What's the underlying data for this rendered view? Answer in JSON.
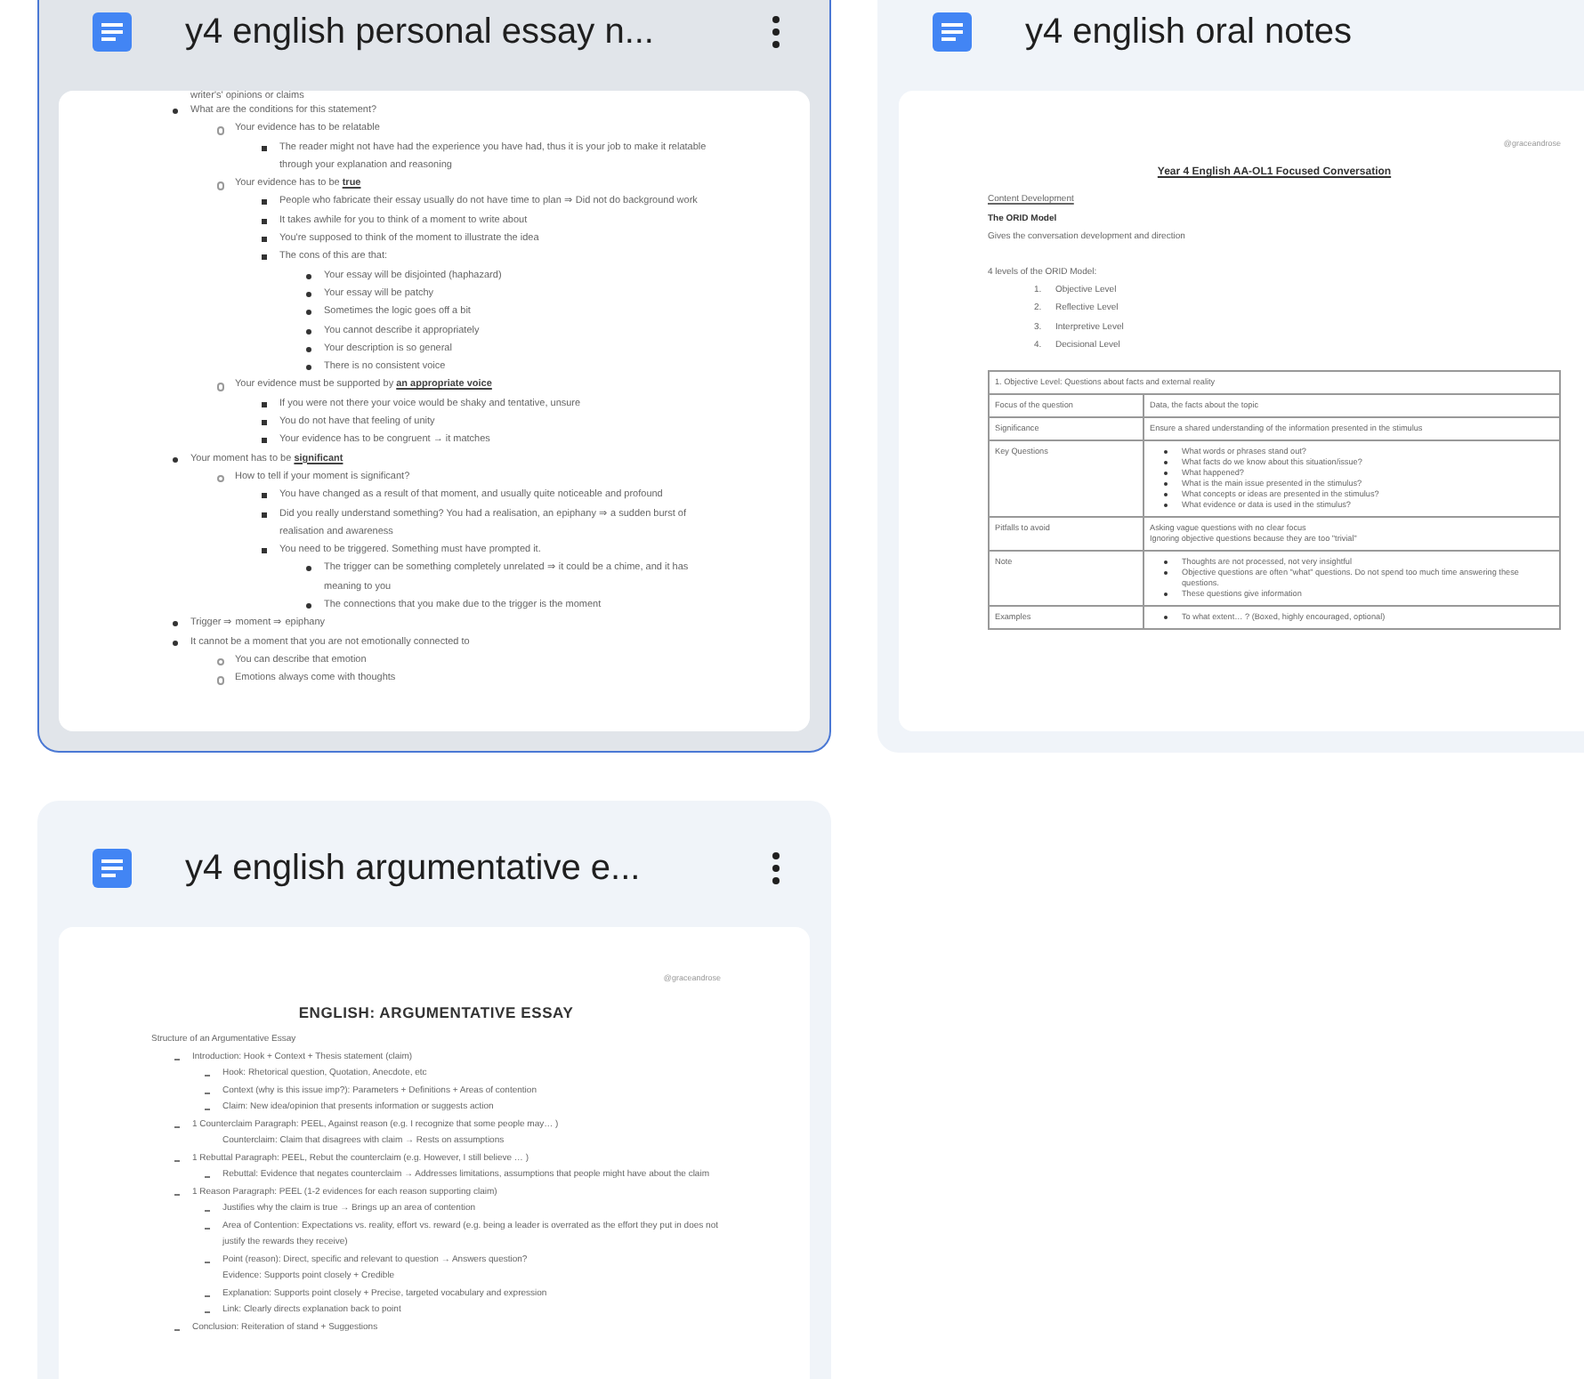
{
  "cards": [
    {
      "title": "y4 english personal essay n...",
      "selected": true,
      "preview": {
        "kind": "dotted_outline",
        "lead_text": "writer's' opinions or claims",
        "items": [
          {
            "text": "What are the conditions for this statement?",
            "children": [
              {
                "text": "Your evidence has to be relatable",
                "children": [
                  {
                    "text": "The reader might not have had the experience you have had, thus it is your job to make it relatable through your explanation and reasoning"
                  }
                ]
              },
              {
                "text": "Your evidence has to be **true**",
                "children": [
                  {
                    "text": "People who fabricate their essay usually do not have time to plan ⇒ Did not do background work"
                  },
                  {
                    "text": "It takes awhile for you to think of a moment to write about"
                  },
                  {
                    "text": "You're supposed to think of the moment to illustrate the idea"
                  },
                  {
                    "text": "The cons of this are that:",
                    "children": [
                      {
                        "text": "Your essay will be disjointed (haphazard)"
                      },
                      {
                        "text": "Your essay will be patchy"
                      },
                      {
                        "text": "Sometimes the logic goes off a bit"
                      },
                      {
                        "text": "You cannot describe it appropriately"
                      },
                      {
                        "text": "Your description is so general"
                      },
                      {
                        "text": "There is no consistent voice"
                      }
                    ]
                  }
                ]
              },
              {
                "text": "Your evidence must be supported by **an appropriate voice**",
                "children": [
                  {
                    "text": "If you were not there your voice would be shaky and tentative, unsure"
                  },
                  {
                    "text": "You do not have that feeling of unity"
                  },
                  {
                    "text": "Your evidence has to be congruent → it matches"
                  }
                ]
              }
            ]
          },
          {
            "text": "Your moment has to be **significant**",
            "children": [
              {
                "text": "How to tell if your moment is significant?",
                "children": [
                  {
                    "text": "You have changed as a result of that moment, and usually quite noticeable and profound"
                  },
                  {
                    "text": "Did you really understand something? You had a realisation, an epiphany ⇒ a sudden burst of realisation and awareness"
                  },
                  {
                    "text": "You need to be triggered. Something must have prompted it.",
                    "children": [
                      {
                        "text": "The trigger can be something completely unrelated ⇒ it could be a chime, and it has meaning to you"
                      },
                      {
                        "text": "The connections that you make due to the trigger is the moment"
                      }
                    ]
                  }
                ]
              }
            ]
          },
          {
            "text": "Trigger ⇒ moment ⇒ epiphany"
          },
          {
            "text": "It cannot be a moment that you are not emotionally connected to",
            "children": [
              {
                "text": "You can describe that emotion"
              },
              {
                "text": "Emotions always come with thoughts"
              }
            ]
          }
        ]
      }
    },
    {
      "title": "y4 english oral notes",
      "selected": false,
      "preview": {
        "kind": "report",
        "handle": "@graceandrose",
        "heading": "Year 4 English AA-OL1 Focused Conversation",
        "section": "Content Development",
        "model": "The ORID Model",
        "model_note": "Gives the conversation development and direction",
        "list_intro": "4 levels of the ORID Model:",
        "levels": [
          {
            "number": "1.",
            "text": "Objective Level"
          },
          {
            "number": "2.",
            "text": "Reflective Level"
          },
          {
            "number": "3.",
            "text": "Interpretive Level"
          },
          {
            "number": "4.",
            "text": "Decisional Level"
          }
        ],
        "table": {
          "title": "1. Objective Level: Questions about facts and external reality",
          "rows": [
            {
              "label": "Focus of the question",
              "bulleted": false,
              "lines": [
                "Data, the facts about the topic"
              ]
            },
            {
              "label": "Significance",
              "bulleted": false,
              "lines": [
                "Ensure a shared understanding of the information presented in the stimulus"
              ]
            },
            {
              "label": "Key Questions",
              "bulleted": true,
              "lines": [
                "What words or phrases stand out?",
                "What facts do we know about this situation/issue?",
                "What happened?",
                "What is the main issue presented in the stimulus?",
                "What concepts or ideas are presented in the stimulus?",
                "What evidence or data is used in the stimulus?"
              ]
            },
            {
              "label": "Pitfalls to avoid",
              "bulleted": false,
              "lines": [
                "Asking vague questions with no clear focus",
                "Ignoring objective questions because they are too \"trivial\""
              ]
            },
            {
              "label": "Note",
              "bulleted": true,
              "lines": [
                "Thoughts are not processed, not very insightful",
                "Objective questions are often \"what\" questions. Do not spend too much time answering these questions.",
                "These questions give information"
              ]
            },
            {
              "label": "Examples",
              "bulleted": true,
              "lines": [
                "To what extent… ? (Boxed, highly encouraged, optional)"
              ]
            }
          ]
        }
      }
    },
    {
      "title": "y4 english argumentative e...",
      "selected": false,
      "preview": {
        "kind": "dashed_outline",
        "handle": "@graceandrose",
        "heading": "ENGLISH: ARGUMENTATIVE ESSAY",
        "intro": "Structure of an Argumentative Essay",
        "items": [
          {
            "text": "Introduction: Hook + Context + Thesis statement (claim)",
            "kind": "dash",
            "children": [
              {
                "text": "Hook: Rhetorical question, Quotation, Anecdote, etc",
                "kind": "dash"
              },
              {
                "text": "Context (why is this issue imp?): Parameters + Definitions + Areas of contention",
                "kind": "dash"
              },
              {
                "text": "Claim: New idea/opinion that presents information or suggests action",
                "kind": "dash"
              }
            ]
          },
          {
            "text": "1 Counterclaim Paragraph: PEEL, Against reason (e.g. I recognize that some people may… )",
            "kind": "dash",
            "children": [
              {
                "text": "Counterclaim: Claim that disagrees with claim → Rests on assumptions",
                "kind": "plain"
              }
            ]
          },
          {
            "text": "1 Rebuttal Paragraph: PEEL, Rebut the counterclaim (e.g. However, I still believe … )",
            "kind": "dash",
            "children": [
              {
                "text": "Rebuttal: Evidence that negates counterclaim → Addresses limitations, assumptions that people might have about the claim",
                "kind": "dash"
              }
            ]
          },
          {
            "text": "1 Reason Paragraph: PEEL (1-2 evidences for each reason supporting claim)",
            "kind": "dash",
            "children": [
              {
                "text": "Justifies why the claim is true → Brings up an area of contention",
                "kind": "dash"
              },
              {
                "text": "Area of Contention: Expectations vs. reality, effort vs. reward (e.g. being a leader is overrated as the effort they put in does not justify the rewards they receive)",
                "kind": "dash"
              },
              {
                "text": "Point (reason): Direct, specific and relevant to question → Answers question?",
                "kind": "dash"
              },
              {
                "text": "Evidence: Supports point closely + Credible",
                "kind": "plain"
              },
              {
                "text": "Explanation: Supports point closely + Precise, targeted vocabulary and expression",
                "kind": "dash"
              },
              {
                "text": "Link: Clearly directs explanation back to point",
                "kind": "dash"
              }
            ]
          },
          {
            "text": "Conclusion: Reiteration of stand + Suggestions",
            "kind": "dash"
          }
        ]
      }
    }
  ]
}
